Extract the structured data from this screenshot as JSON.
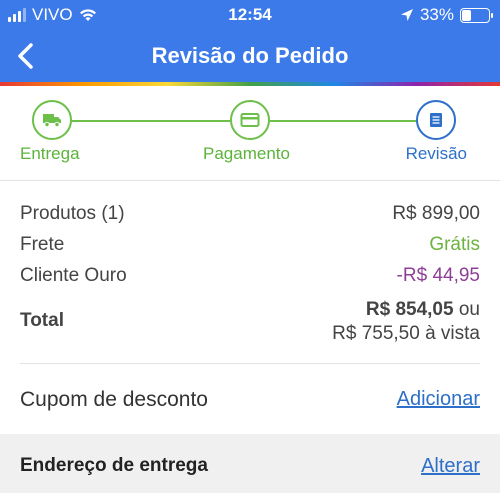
{
  "status_bar": {
    "carrier": "VIVO",
    "time": "12:54",
    "battery_percent": "33%",
    "battery_level": 0.33
  },
  "nav": {
    "back_icon": "chevron-left-icon",
    "title": "Revisão do Pedido"
  },
  "colors": {
    "header_blue": "#3b7ae8",
    "step_green": "#6cc04a",
    "step_active_blue": "#2d6fc9",
    "discount_purple": "#8e3f97"
  },
  "steps": [
    {
      "label": "Entrega",
      "icon": "truck-icon",
      "state": "done"
    },
    {
      "label": "Pagamento",
      "icon": "credit-card-icon",
      "state": "done"
    },
    {
      "label": "Revisão",
      "icon": "document-icon",
      "state": "active"
    }
  ],
  "summary": {
    "products_label": "Produtos (1)",
    "products_value": "R$ 899,00",
    "shipping_label": "Frete",
    "shipping_value": "Grátis",
    "gold_label": "Cliente Ouro",
    "gold_value": "-R$ 44,95",
    "total_label": "Total",
    "total_value": "R$ 854,05",
    "total_or": "ou",
    "total_cash": "R$ 755,50 à vista"
  },
  "coupon": {
    "label": "Cupom de desconto",
    "action": "Adicionar"
  },
  "address": {
    "label": "Endereço de entrega",
    "action": "Alterar"
  }
}
